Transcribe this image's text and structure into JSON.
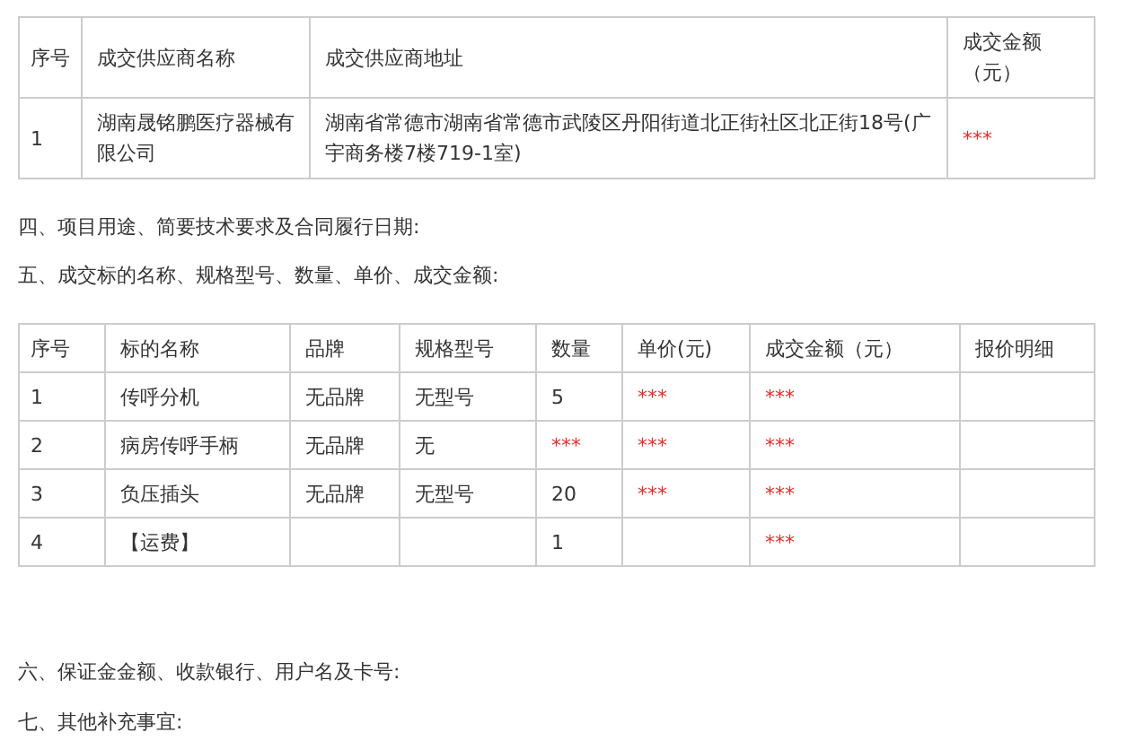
{
  "supplier_table": {
    "columns": [
      "序号",
      "成交供应商名称",
      "成交供应商地址",
      "成交金额（元）"
    ],
    "rows": [
      [
        {
          "kind": "text",
          "text": "1"
        },
        {
          "kind": "text",
          "text": "湖南晟铭鹏医疗器械有限公司"
        },
        {
          "kind": "text",
          "text": "湖南省常德市湖南省常德市武陵区丹阳街道北正街社区北正街18号(广宇商务楼7楼719-1室)"
        },
        {
          "kind": "masked",
          "text": "***"
        }
      ]
    ]
  },
  "sections_before": [
    "四、项目用途、简要技术要求及合同履行日期:",
    "五、成交标的名称、规格型号、数量、单价、成交金额:"
  ],
  "items_table": {
    "columns": [
      "序号",
      "标的名称",
      "品牌",
      "规格型号",
      "数量",
      "单价(元)",
      "成交金额（元）",
      "报价明细"
    ],
    "rows": [
      [
        {
          "kind": "text",
          "text": "1"
        },
        {
          "kind": "text",
          "text": "传呼分机"
        },
        {
          "kind": "text",
          "text": "无品牌"
        },
        {
          "kind": "text",
          "text": "无型号"
        },
        {
          "kind": "text",
          "text": "5"
        },
        {
          "kind": "masked",
          "text": "***"
        },
        {
          "kind": "masked",
          "text": "***"
        },
        null
      ],
      [
        {
          "kind": "text",
          "text": "2"
        },
        {
          "kind": "text",
          "text": "病房传呼手柄"
        },
        {
          "kind": "text",
          "text": "无品牌"
        },
        {
          "kind": "text",
          "text": "无"
        },
        {
          "kind": "masked",
          "text": "***"
        },
        {
          "kind": "masked",
          "text": "***"
        },
        {
          "kind": "masked",
          "text": "***"
        },
        null
      ],
      [
        {
          "kind": "text",
          "text": "3"
        },
        {
          "kind": "text",
          "text": "负压插头"
        },
        {
          "kind": "text",
          "text": "无品牌"
        },
        {
          "kind": "text",
          "text": "无型号"
        },
        {
          "kind": "text",
          "text": "20"
        },
        {
          "kind": "masked",
          "text": "***"
        },
        {
          "kind": "masked",
          "text": "***"
        },
        null
      ],
      [
        {
          "kind": "text",
          "text": "4"
        },
        {
          "kind": "text",
          "text": "【运费】"
        },
        null,
        null,
        {
          "kind": "text",
          "text": "1"
        },
        null,
        {
          "kind": "masked",
          "text": "***"
        },
        null
      ]
    ]
  },
  "sections_after": [
    "六、保证金金额、收款银行、用户名及卡号:",
    "七、其他补充事宜:"
  ]
}
